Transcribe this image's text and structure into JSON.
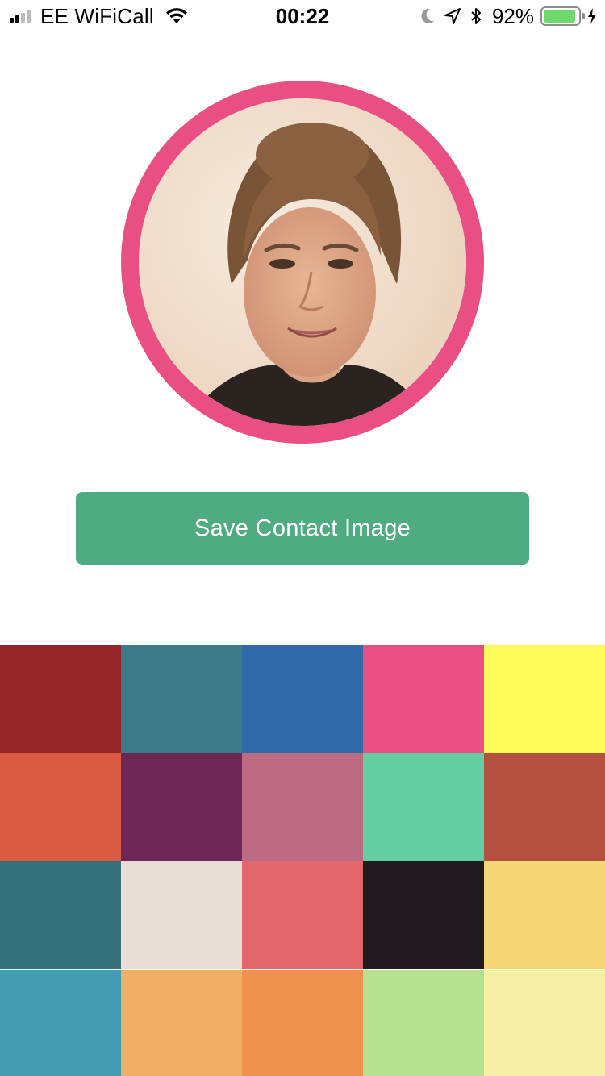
{
  "status_bar": {
    "carrier": "EE WiFiCall",
    "time": "00:22",
    "battery_percent": "92%",
    "battery_level": 0.92,
    "signal_bars": 4,
    "signal_bars_active": 2,
    "icons": [
      "signal-icon",
      "wifi-icon",
      "moon-icon",
      "location-arrow-icon",
      "bluetooth-icon",
      "battery-icon",
      "charging-bolt-icon"
    ]
  },
  "avatar": {
    "ring_color": "#e94f82"
  },
  "save_button": {
    "label": "Save Contact Image",
    "color": "#4eab82"
  },
  "swatches": [
    "#952427",
    "#3d7a89",
    "#3069a7",
    "#e94f82",
    "#fefb5a",
    "#d95a43",
    "#6e2656",
    "#bd6b82",
    "#63cea1",
    "#b65041",
    "#35717a",
    "#e9ded6",
    "#e3666c",
    "#211a1e",
    "#f5d778",
    "#449cb3",
    "#efb066",
    "#ef9250",
    "#b6e290",
    "#f5f0a3"
  ]
}
